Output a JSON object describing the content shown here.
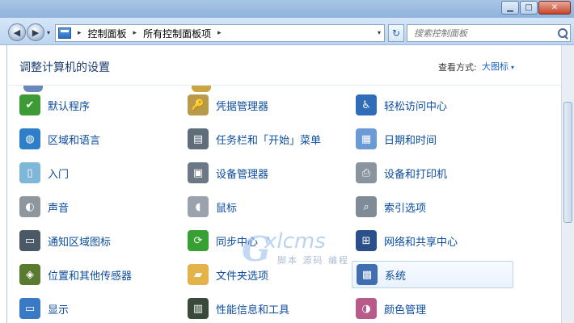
{
  "window": {
    "minimize_glyph": "▁",
    "maximize_glyph": "□",
    "close_glyph": "✕"
  },
  "nav": {
    "back_glyph": "◀",
    "forward_glyph": "▶",
    "dropdown_glyph": "▾",
    "breadcrumbs": [
      "控制面板",
      "所有控制面板项"
    ],
    "breadcrumb_separator": "▸",
    "address_dropdown_glyph": "▾",
    "refresh_glyph": "↻",
    "search_placeholder": "搜索控制面板"
  },
  "header": {
    "title": "调整计算机的设置",
    "view_label": "查看方式:",
    "view_value": "大图标",
    "view_caret": "▾"
  },
  "items": [
    {
      "label": "默认程序",
      "icon": "default-programs-icon",
      "color": "#3c9b35",
      "glyph": "✔"
    },
    {
      "label": "凭据管理器",
      "icon": "credential-manager-icon",
      "color": "#b89a4a",
      "glyph": "🔑"
    },
    {
      "label": "轻松访问中心",
      "icon": "ease-of-access-icon",
      "color": "#2f6db8",
      "glyph": "♿"
    },
    {
      "label": "区域和语言",
      "icon": "region-language-icon",
      "color": "#2f7fc8",
      "glyph": "◍"
    },
    {
      "label": "任务栏和「开始」菜单",
      "icon": "taskbar-start-icon",
      "color": "#5f6c7a",
      "glyph": "▤"
    },
    {
      "label": "日期和时间",
      "icon": "date-time-icon",
      "color": "#6a9bd4",
      "glyph": "▦"
    },
    {
      "label": "入门",
      "icon": "getting-started-icon",
      "color": "#7fb7d8",
      "glyph": "▯"
    },
    {
      "label": "设备管理器",
      "icon": "device-manager-icon",
      "color": "#6d7886",
      "glyph": "▣"
    },
    {
      "label": "设备和打印机",
      "icon": "devices-printers-icon",
      "color": "#8a949e",
      "glyph": "⎙"
    },
    {
      "label": "声音",
      "icon": "sound-icon",
      "color": "#8e969e",
      "glyph": "◐"
    },
    {
      "label": "鼠标",
      "icon": "mouse-icon",
      "color": "#9aa3ad",
      "glyph": "◖"
    },
    {
      "label": "索引选项",
      "icon": "indexing-icon",
      "color": "#7f8b97",
      "glyph": "⌕"
    },
    {
      "label": "通知区域图标",
      "icon": "notification-area-icon",
      "color": "#4b5866",
      "glyph": "▭"
    },
    {
      "label": "同步中心",
      "icon": "sync-center-icon",
      "color": "#36a032",
      "glyph": "⟳"
    },
    {
      "label": "网络和共享中心",
      "icon": "network-sharing-icon",
      "color": "#2a4f8a",
      "glyph": "⊞"
    },
    {
      "label": "位置和其他传感器",
      "icon": "location-sensors-icon",
      "color": "#5a7a2f",
      "glyph": "◈"
    },
    {
      "label": "文件夹选项",
      "icon": "folder-options-icon",
      "color": "#e3b34a",
      "glyph": "▰"
    },
    {
      "label": "系统",
      "icon": "system-icon",
      "color": "#3f6fb0",
      "glyph": "▩"
    },
    {
      "label": "显示",
      "icon": "display-icon",
      "color": "#3a79c4",
      "glyph": "▭"
    },
    {
      "label": "性能信息和工具",
      "icon": "performance-icon",
      "color": "#3a4a3a",
      "glyph": "▥"
    },
    {
      "label": "颜色管理",
      "icon": "color-management-icon",
      "color": "#b85a8a",
      "glyph": "◑"
    }
  ],
  "selected_item": "系统",
  "watermark": {
    "letter": "G",
    "text": "xlcms",
    "subtext": "脚本 源码 编程"
  }
}
